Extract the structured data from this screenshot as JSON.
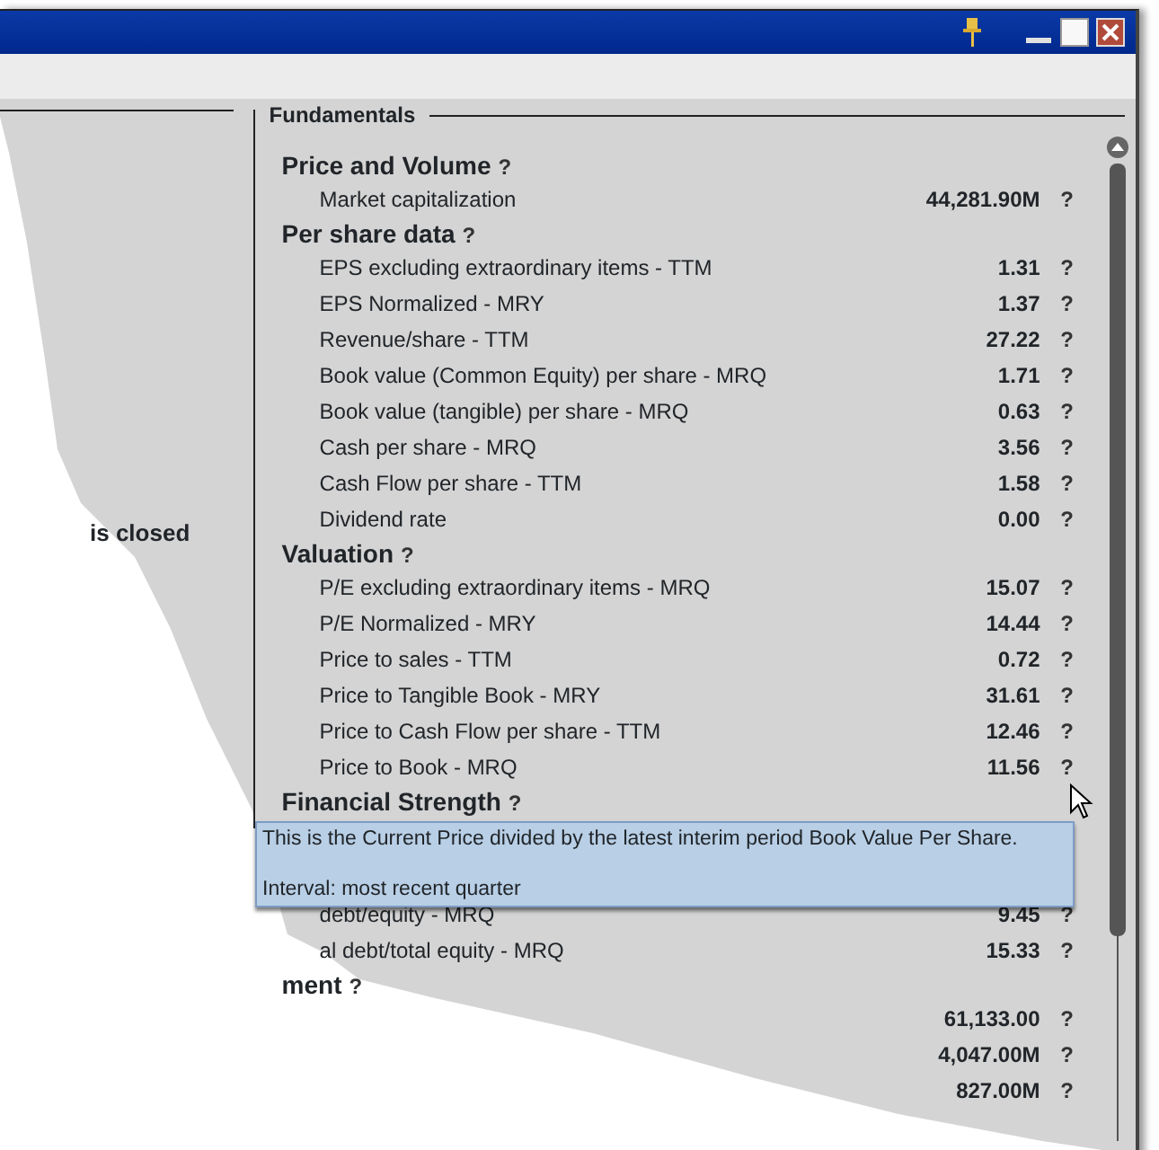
{
  "left_panel": {
    "text": "is closed"
  },
  "fundamentals": {
    "title": "Fundamentals",
    "sections": [
      {
        "heading": "Price and Volume",
        "help": "?",
        "rows": [
          {
            "label": "Market capitalization",
            "value": "44,281.90M",
            "help": "?"
          }
        ]
      },
      {
        "heading": "Per share data",
        "help": "?",
        "rows": [
          {
            "label": "EPS excluding extraordinary items - TTM",
            "value": "1.31",
            "help": "?"
          },
          {
            "label": "EPS Normalized - MRY",
            "value": "1.37",
            "help": "?"
          },
          {
            "label": "Revenue/share - TTM",
            "value": "27.22",
            "help": "?"
          },
          {
            "label": "Book value (Common Equity) per share - MRQ",
            "value": "1.71",
            "help": "?"
          },
          {
            "label": "Book value (tangible) per share - MRQ",
            "value": "0.63",
            "help": "?"
          },
          {
            "label": "Cash per share  - MRQ",
            "value": "3.56",
            "help": "?"
          },
          {
            "label": "Cash Flow per share - TTM",
            "value": "1.58",
            "help": "?"
          },
          {
            "label": "Dividend rate",
            "value": "0.00",
            "help": "?"
          }
        ]
      },
      {
        "heading": "Valuation",
        "help": "?",
        "rows": [
          {
            "label": "P/E excluding extraordinary items - MRQ",
            "value": "15.07",
            "help": "?"
          },
          {
            "label": "P/E Normalized - MRY",
            "value": "14.44",
            "help": "?"
          },
          {
            "label": "Price to sales - TTM",
            "value": "0.72",
            "help": "?"
          },
          {
            "label": "Price to Tangible Book - MRY",
            "value": "31.61",
            "help": "?"
          },
          {
            "label": "Price to Cash Flow per share - TTM",
            "value": "12.46",
            "help": "?"
          },
          {
            "label": "Price to Book - MRQ",
            "value": "11.56",
            "help": "?"
          }
        ]
      },
      {
        "heading": "Financial Strength",
        "help": "?",
        "rows": [
          {
            "label": "debt/equity - MRQ",
            "value": "9.45",
            "help": "?"
          },
          {
            "label": "al debt/total equity - MRQ",
            "value": "15.33",
            "help": "?"
          }
        ]
      },
      {
        "heading": "ment",
        "help": "?",
        "rows": [
          {
            "value": "61,133.00",
            "help": "?"
          },
          {
            "value": "4,047.00M",
            "help": "?"
          },
          {
            "value": "827.00M",
            "help": "?"
          }
        ]
      }
    ]
  },
  "tooltip": {
    "lines": [
      "This is the Current Price divided by the latest interim period Book Value Per Share.",
      "Interval: most recent quarter"
    ]
  }
}
